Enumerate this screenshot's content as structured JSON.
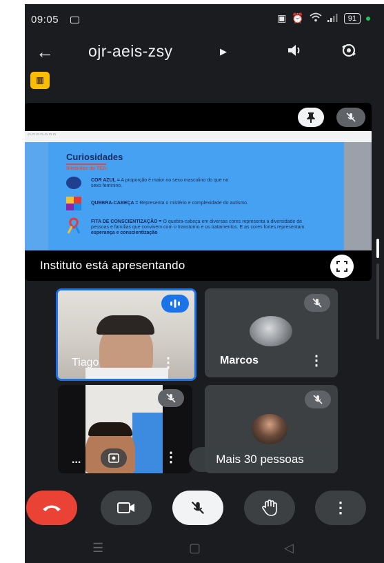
{
  "status_bar": {
    "time": "09:05",
    "battery": "91",
    "signal_icons": [
      "nfc-icon",
      "alarm-icon",
      "wifi-icon",
      "signal-icon"
    ]
  },
  "header": {
    "meeting_code": "ojr-aeis-zsy",
    "back_icon": "arrow-left-icon",
    "speaker_icon": "speaker-icon",
    "switch_camera_icon": "switch-camera-icon"
  },
  "recording_badge": {
    "icon": "room-badge-icon"
  },
  "presentation": {
    "label": "Instituto está apresentando",
    "slide": {
      "title": "Curiosidades",
      "subtitle": "Símbolos do TEA:",
      "items": [
        {
          "heading": "COR AZUL =",
          "text": "A proporção é maior no sexo masculino do que no sexo feminino."
        },
        {
          "heading": "QUEBRA-CABEÇA =",
          "text": "Representa o mistério e complexidade do autismo."
        },
        {
          "heading": "FITA DE CONSCIENTIZAÇÃO =",
          "text": "O quebra-cabeça em diversas cores representa a diversidade de pessoas e famílias que convivem com o transtorno e os tratamentos. E as cores fortes representam",
          "emphasis": "esperança e conscientização"
        }
      ]
    }
  },
  "participants": [
    {
      "name": "Tiago",
      "speaking": true,
      "muted": false
    },
    {
      "name": "Marcos",
      "speaking": false,
      "muted": true
    },
    {
      "name": "...",
      "speaking": false,
      "muted": true
    },
    {
      "name": "Mais 30 pessoas",
      "speaking": false,
      "muted": true
    }
  ],
  "controls": {
    "end_call_color": "#ea4335",
    "accent_blue": "#1a73e8"
  }
}
